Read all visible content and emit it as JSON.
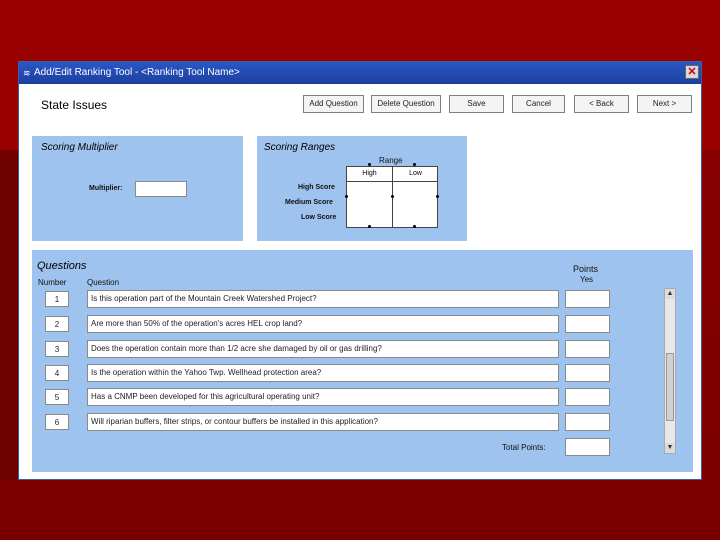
{
  "window": {
    "title": "Add/Edit Ranking Tool - <Ranking Tool Name>",
    "close_label": "✕"
  },
  "page_title": "State Issues",
  "toolbar": {
    "add_question": "Add Question",
    "delete_question": "Delete Question",
    "save": "Save",
    "cancel": "Cancel",
    "back": "< Back",
    "next": "Next >"
  },
  "scoring_multiplier": {
    "title": "Scoring Multiplier",
    "multiplier_label": "Multiplier:",
    "multiplier_value": ""
  },
  "scoring_ranges": {
    "title": "Scoring Ranges",
    "range_label": "Range",
    "high_header": "High",
    "low_header": "Low",
    "rows": [
      "High Score",
      "Medium Score",
      "Low Score"
    ]
  },
  "questions": {
    "title": "Questions",
    "number_header": "Number",
    "question_header": "Question",
    "points_header": "Points",
    "yes_header": "Yes",
    "total_label": "Total Points:",
    "total_value": "",
    "items": [
      {
        "number": "1",
        "question": "Is this operation part of the Mountain Creek Watershed Project?",
        "points": ""
      },
      {
        "number": "2",
        "question": "Are more than 50% of the operation's acres HEL crop land?",
        "points": ""
      },
      {
        "number": "3",
        "question": "Does the operation contain more than 1/2 acre she damaged by oil or gas drilling?",
        "points": ""
      },
      {
        "number": "4",
        "question": "Is the operation within the Yahoo Twp. Wellhead protection area?",
        "points": ""
      },
      {
        "number": "5",
        "question": "Has a CNMP been developed for this agricultural operating unit?",
        "points": ""
      },
      {
        "number": "6",
        "question": "Will riparian buffers, filter strips, or contour buffers be installed in this application?",
        "points": ""
      }
    ]
  },
  "colors": {
    "panel": "#9ec3ef",
    "titlebar": "#2a57c6",
    "background": "#8b0000"
  }
}
